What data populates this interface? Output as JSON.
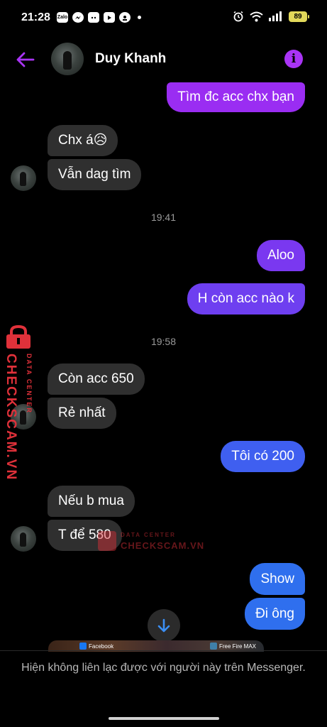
{
  "status_bar": {
    "time": "21:28",
    "left_icons": [
      "zalo-icon",
      "messenger-icon",
      "discord-icon",
      "play-icon",
      "app-icon"
    ],
    "zalo_label": "Zalo",
    "battery": "89",
    "right_icons": [
      "alarm-icon",
      "wifi-icon",
      "signal-icon",
      "battery-icon"
    ]
  },
  "header": {
    "contact_name": "Duy Khanh",
    "back_icon": "back-arrow-icon",
    "info_icon": "info-icon",
    "accent_color": "#a934f5"
  },
  "messages": [
    {
      "side": "out",
      "text": "Tìm đc acc chx bạn"
    },
    {
      "side": "in",
      "text": "Chx á😥"
    },
    {
      "side": "in",
      "text": "Vẫn dag tìm"
    },
    {
      "side": "time",
      "text": "19:41"
    },
    {
      "side": "out",
      "text": "Aloo"
    },
    {
      "side": "out",
      "text": "H còn acc nào k"
    },
    {
      "side": "time",
      "text": "19:58"
    },
    {
      "side": "in",
      "text": "Còn acc 650"
    },
    {
      "side": "in",
      "text": "Rẻ nhất"
    },
    {
      "side": "out",
      "text": "Tôi có 200"
    },
    {
      "side": "in",
      "text": "Nếu b mua"
    },
    {
      "side": "in",
      "text": "T để 580"
    },
    {
      "side": "out",
      "text": "Show"
    },
    {
      "side": "out",
      "text": "Đi ông"
    }
  ],
  "watermark": {
    "brand": "CHECKSCAM.VN",
    "sub": "DATA CENTER"
  },
  "preview": {
    "left_label": "Facebook",
    "right_label": "Free Fire MAX"
  },
  "notice": "Hiện không liên lạc được với người này trên Messenger.",
  "colors": {
    "incoming_bubble": "#2f2f2f",
    "outgoing_purple": "#9a2df2",
    "outgoing_violet": "#6e3ff0",
    "outgoing_blue": "#2f6fee",
    "watermark_red": "#e0313a"
  }
}
